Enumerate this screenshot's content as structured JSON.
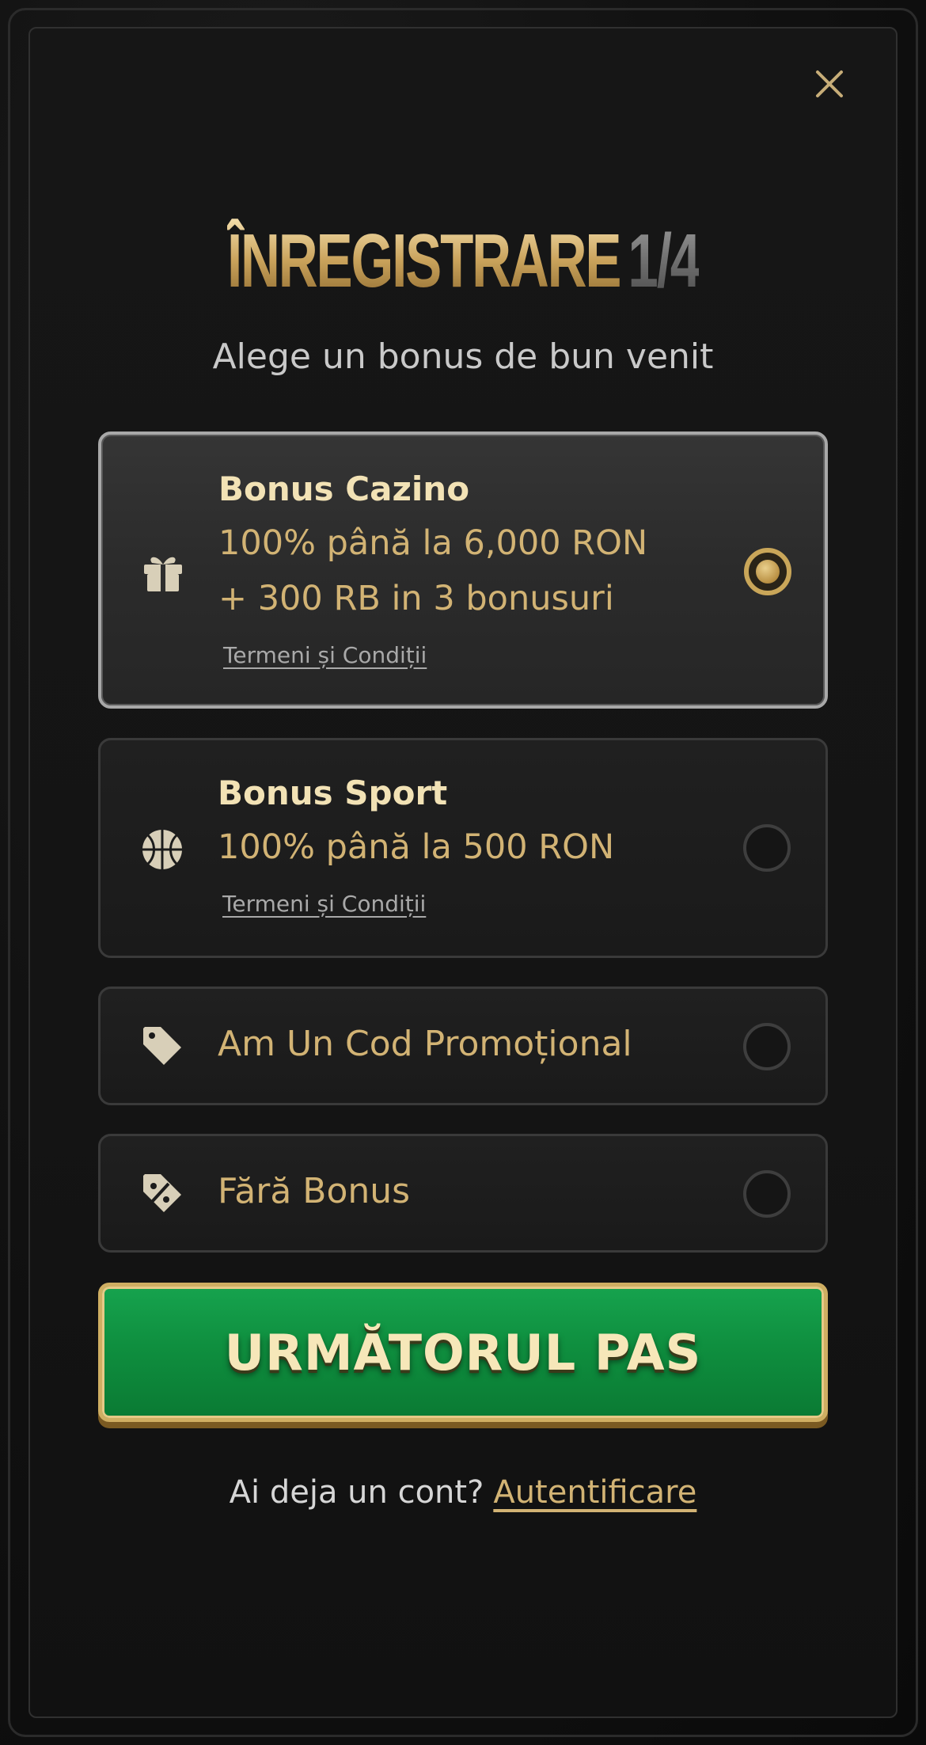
{
  "header": {
    "title_main": "ÎNREGISTRARE",
    "title_step": "1/4",
    "subtitle": "Alege un bonus de bun venit"
  },
  "options": [
    {
      "title": "Bonus Cazino",
      "lines": [
        "100% până la 6,000 RON",
        "+ 300 RB in 3 bonusuri"
      ],
      "terms": "Termeni și Condiții",
      "icon": "gift-icon",
      "selected": true
    },
    {
      "title": "Bonus Sport",
      "lines": [
        "100% până la 500 RON"
      ],
      "terms": "Termeni și Condiții",
      "icon": "basketball-icon",
      "selected": false
    },
    {
      "label": "Am Un Cod Promoțional",
      "icon": "tag-icon",
      "selected": false
    },
    {
      "label": "Fără Bonus",
      "icon": "no-discount-icon",
      "selected": false
    }
  ],
  "cta": {
    "label": "URMĂTORUL PAS"
  },
  "footer": {
    "question": "Ai deja un cont?",
    "login_link": "Autentificare"
  },
  "colors": {
    "gold": "#d2b374",
    "cream": "#f2e2b5",
    "green": "#0f8f3f",
    "background": "#141414"
  }
}
